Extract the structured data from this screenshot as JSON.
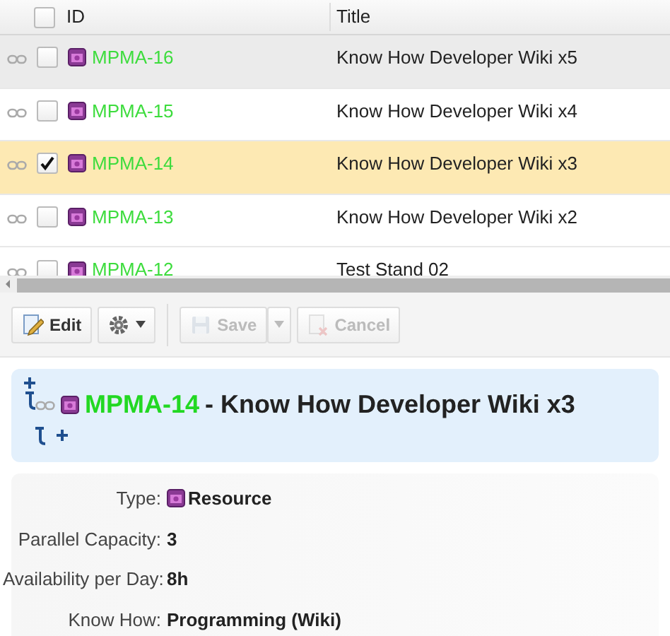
{
  "grid": {
    "header_checked": false,
    "columns": [
      {
        "label": "ID"
      },
      {
        "label": "Title"
      }
    ],
    "rows": [
      {
        "id": "MPMA-16",
        "title": "Know How Developer Wiki x5",
        "checked": false,
        "hovered": true
      },
      {
        "id": "MPMA-15",
        "title": "Know How Developer Wiki x4",
        "checked": false,
        "hovered": false
      },
      {
        "id": "MPMA-14",
        "title": "Know How Developer Wiki x3",
        "checked": true,
        "hovered": false
      },
      {
        "id": "MPMA-13",
        "title": "Know How Developer Wiki x2",
        "checked": false,
        "hovered": false
      },
      {
        "id": "MPMA-12",
        "title": "Test Stand 02",
        "checked": false,
        "hovered": false
      }
    ]
  },
  "toolbar": [
    {
      "kind": "edit",
      "label": "Edit",
      "disabled": false
    },
    {
      "kind": "settings",
      "disabled": false
    },
    {
      "kind": "save",
      "label": "Save",
      "disabled": true
    },
    {
      "kind": "cancel",
      "label": "Cancel",
      "disabled": true
    }
  ],
  "record": {
    "id": "MPMA-14",
    "title": "- Know How Developer Wiki x3"
  },
  "details": [
    {
      "label": "Type:",
      "value": "Resource",
      "kind": "typed"
    },
    {
      "label": "Parallel Capacity:",
      "value": "3",
      "kind": "plain"
    },
    {
      "label": "Availability per Day:",
      "value": "8h",
      "kind": "plain"
    },
    {
      "label": "Know How:",
      "value": "Programming (Wiki)",
      "kind": "plain"
    }
  ]
}
